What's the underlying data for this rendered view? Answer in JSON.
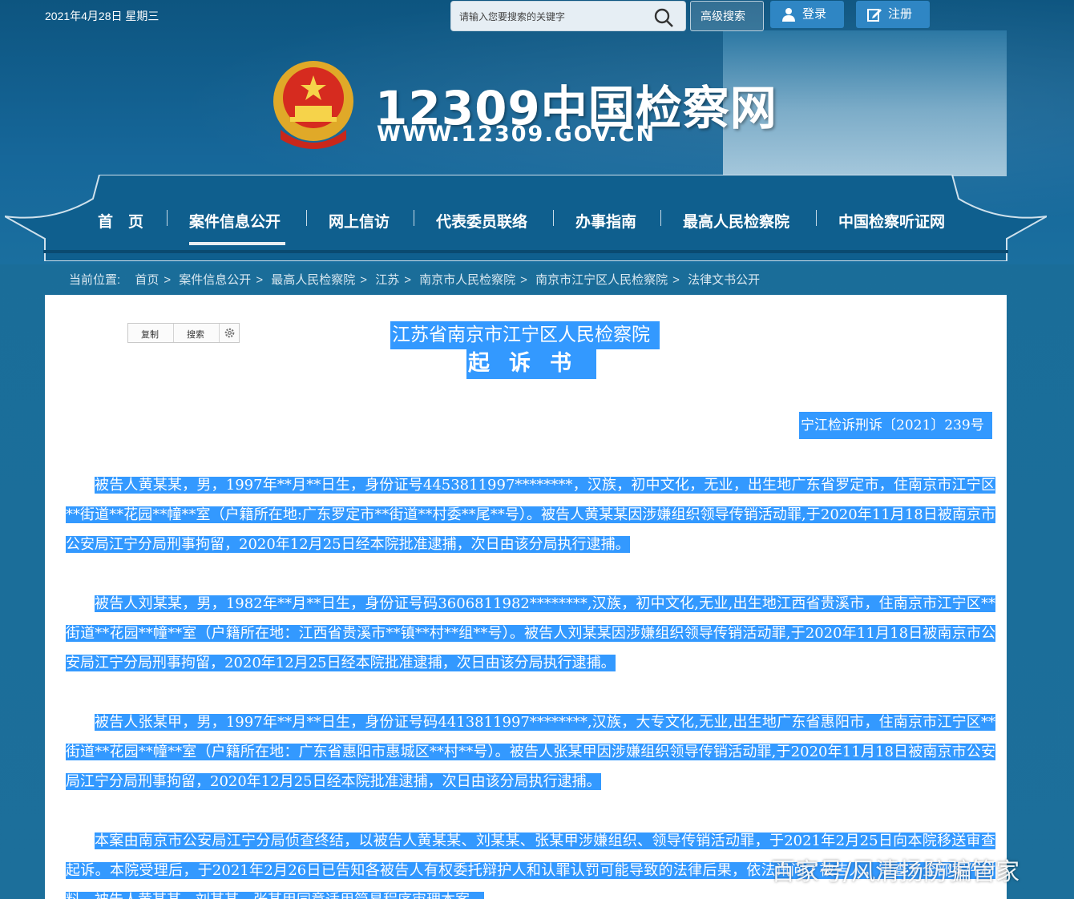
{
  "topbar": {
    "date": "2021年4月28日 星期三",
    "search_placeholder": "请输入您要搜索的关键字",
    "advanced_search": "高级搜索",
    "login": "登录",
    "register": "注册"
  },
  "logo": {
    "title": "12309中国检察网",
    "url": "WWW.12309.GOV.CN"
  },
  "nav": {
    "items": [
      "首　页",
      "案件信息公开",
      "网上信访",
      "代表委员联络",
      "办事指南",
      "最高人民检察院",
      "中国检察听证网"
    ],
    "active_index": 1
  },
  "breadcrumb": {
    "label": "当前位置:",
    "items": [
      "首页",
      "案件信息公开",
      "最高人民检察院",
      "江苏",
      "南京市人民检察院",
      "南京市江宁区人民检察院",
      "法律文书公开"
    ],
    "separator": ">"
  },
  "toolbar": {
    "copy": "复制",
    "search": "搜索"
  },
  "document": {
    "org": "江苏省南京市江宁区人民检察院",
    "title": "起诉书",
    "number": "宁江检诉刑诉〔2021〕239号",
    "paragraphs": [
      "被告人黄某某，男，1997年**月**日生，身份证号4453811997********，汉族，初中文化，无业，出生地广东省罗定市，住南京市江宁区**街道**花园**幢**室（户籍所在地:广东罗定市**街道**村委**尾**号）。被告人黄某某因涉嫌组织领导传销活动罪,于2020年11月18日被南京市公安局江宁分局刑事拘留，2020年12月25日经本院批准逮捕，次日由该分局执行逮捕。",
      "被告人刘某某，男，1982年**月**日生，身份证号码3606811982********,汉族，初中文化,无业,出生地江西省贵溪市，住南京市江宁区**街道**花园**幢**室（户籍所在地：江西省贵溪市**镇**村**组**号）。被告人刘某某因涉嫌组织领导传销活动罪,于2020年11月18日被南京市公安局江宁分局刑事拘留，2020年12月25日经本院批准逮捕，次日由该分局执行逮捕。",
      "被告人张某甲，男，1997年**月**日生，身份证号码4413811997********,汉族，大专文化,无业,出生地广东省惠阳市，住南京市江宁区**街道**花园**幢**室（户籍所在地：广东省惠阳市惠城区**村**号）。被告人张某甲因涉嫌组织领导传销活动罪,于2020年11月18日被南京市公安局江宁分局刑事拘留，2020年12月25日经本院批准逮捕，次日由该分局执行逮捕。",
      "本案由南京市公安局江宁分局侦查终结，以被告人黄某某、刘某某、张某甲涉嫌组织、领导传销活动罪，于2021年2月25日向本院移送审查起诉。本院受理后，于2021年2月26日已告知各被告人有权委托辩护人和认罪认罚可能导致的法律后果，依法讯问了被告人，审查了全部案件材料。被告人黄某某、刘某某、张某甲同意适用简易程序审理本案。"
    ]
  },
  "watermark": "百家号/风清扬防骗管家",
  "colors": {
    "header_blue": "#0d5580",
    "selection": "#3399ff",
    "button_blue": "#2f86c4"
  }
}
